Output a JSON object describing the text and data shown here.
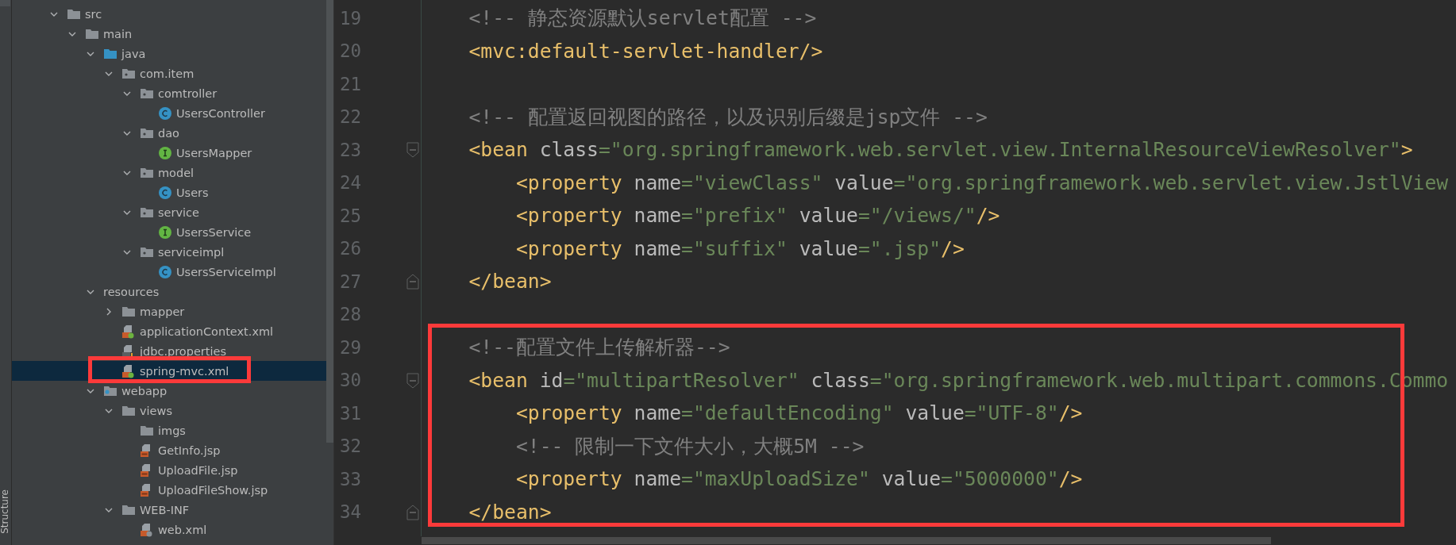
{
  "side_strip": {
    "tab": "Structure"
  },
  "project_tree": {
    "items": [
      {
        "name": "src",
        "kind": "folder",
        "expanded": true,
        "selected": false,
        "boxed": false,
        "children": [
          {
            "name": "main",
            "kind": "folder",
            "expanded": true,
            "selected": false,
            "boxed": false,
            "children": [
              {
                "name": "java",
                "kind": "source-folder",
                "expanded": true,
                "selected": false,
                "boxed": false,
                "children": [
                  {
                    "name": "com.item",
                    "kind": "package",
                    "expanded": true,
                    "selected": false,
                    "boxed": false,
                    "children": [
                      {
                        "name": "comtroller",
                        "kind": "package",
                        "expanded": true,
                        "selected": false,
                        "boxed": false,
                        "children": [
                          {
                            "name": "UsersController",
                            "kind": "class",
                            "selected": false,
                            "boxed": false
                          }
                        ]
                      },
                      {
                        "name": "dao",
                        "kind": "package",
                        "expanded": true,
                        "selected": false,
                        "boxed": false,
                        "children": [
                          {
                            "name": "UsersMapper",
                            "kind": "interface",
                            "selected": false,
                            "boxed": false
                          }
                        ]
                      },
                      {
                        "name": "model",
                        "kind": "package",
                        "expanded": true,
                        "selected": false,
                        "boxed": false,
                        "children": [
                          {
                            "name": "Users",
                            "kind": "class",
                            "selected": false,
                            "boxed": false
                          }
                        ]
                      },
                      {
                        "name": "service",
                        "kind": "package",
                        "expanded": true,
                        "selected": false,
                        "boxed": false,
                        "children": [
                          {
                            "name": "UsersService",
                            "kind": "interface",
                            "selected": false,
                            "boxed": false
                          }
                        ]
                      },
                      {
                        "name": "serviceimpl",
                        "kind": "package",
                        "expanded": true,
                        "selected": false,
                        "boxed": false,
                        "children": [
                          {
                            "name": "UsersServiceImpl",
                            "kind": "class",
                            "selected": false,
                            "boxed": false
                          }
                        ]
                      }
                    ]
                  }
                ]
              },
              {
                "name": "resources",
                "kind": "plain",
                "expanded": true,
                "selected": false,
                "boxed": false,
                "children": [
                  {
                    "name": "mapper",
                    "kind": "folder",
                    "expanded": false,
                    "selected": false,
                    "boxed": false
                  },
                  {
                    "name": "applicationContext.xml",
                    "kind": "spring-xml",
                    "selected": false,
                    "boxed": false
                  },
                  {
                    "name": "jdbc.properties",
                    "kind": "properties",
                    "selected": false,
                    "boxed": false
                  },
                  {
                    "name": "spring-mvc.xml",
                    "kind": "spring-xml",
                    "selected": true,
                    "boxed": true
                  }
                ]
              },
              {
                "name": "webapp",
                "kind": "web-folder",
                "expanded": true,
                "selected": false,
                "boxed": false,
                "children": [
                  {
                    "name": "views",
                    "kind": "folder",
                    "expanded": true,
                    "selected": false,
                    "boxed": false,
                    "children": [
                      {
                        "name": "imgs",
                        "kind": "folder",
                        "selected": false,
                        "boxed": false
                      },
                      {
                        "name": "GetInfo.jsp",
                        "kind": "jsp",
                        "selected": false,
                        "boxed": false
                      },
                      {
                        "name": "UploadFile.jsp",
                        "kind": "jsp",
                        "selected": false,
                        "boxed": false
                      },
                      {
                        "name": "UploadFileShow.jsp",
                        "kind": "jsp",
                        "selected": false,
                        "boxed": false
                      }
                    ]
                  },
                  {
                    "name": "WEB-INF",
                    "kind": "folder",
                    "expanded": true,
                    "selected": false,
                    "boxed": false,
                    "children": [
                      {
                        "name": "web.xml",
                        "kind": "web-xml",
                        "selected": false,
                        "boxed": false
                      }
                    ]
                  }
                ]
              }
            ]
          }
        ]
      }
    ]
  },
  "editor": {
    "lines": [
      {
        "number": "19",
        "kind": "code",
        "boxed": false,
        "tokens": [
          {
            "kind": "comment",
            "text": "    <!-- 静态资源默认servlet配置 -->"
          }
        ]
      },
      {
        "number": "20",
        "kind": "code",
        "boxed": false,
        "tokens": [
          {
            "kind": "tag",
            "text": "    <mvc:default-servlet-handler/>"
          }
        ]
      },
      {
        "number": "21",
        "kind": "code",
        "boxed": false
      },
      {
        "number": "22",
        "kind": "code",
        "boxed": false,
        "tokens": [
          {
            "kind": "comment",
            "text": "    <!-- 配置返回视图的路径，以及识别后缀是jsp文件 -->"
          }
        ]
      },
      {
        "number": "23",
        "kind": "fold-start",
        "boxed": false,
        "tokens": [
          {
            "kind": "tag",
            "text": "    <bean"
          },
          {
            "kind": "attr",
            "text": " class"
          },
          {
            "kind": "string",
            "text": "=\"org.springframework.web.servlet.view.InternalResourceViewResolver\""
          },
          {
            "kind": "tag",
            "text": ">"
          }
        ]
      },
      {
        "number": "24",
        "kind": "code",
        "boxed": false,
        "tokens": [
          {
            "kind": "tag",
            "text": "        <property"
          },
          {
            "kind": "attr",
            "text": " name"
          },
          {
            "kind": "string",
            "text": "=\"viewClass\""
          },
          {
            "kind": "attr",
            "text": " value"
          },
          {
            "kind": "string",
            "text": "=\"org.springframework.web.servlet.view.JstlView"
          }
        ]
      },
      {
        "number": "25",
        "kind": "code",
        "boxed": false,
        "tokens": [
          {
            "kind": "tag",
            "text": "        <property"
          },
          {
            "kind": "attr",
            "text": " name"
          },
          {
            "kind": "string",
            "text": "=\"prefix\""
          },
          {
            "kind": "attr",
            "text": " value"
          },
          {
            "kind": "string",
            "text": "=\"/views/\""
          },
          {
            "kind": "tag",
            "text": "/>"
          }
        ]
      },
      {
        "number": "26",
        "kind": "code",
        "boxed": false,
        "tokens": [
          {
            "kind": "tag",
            "text": "        <property"
          },
          {
            "kind": "attr",
            "text": " name"
          },
          {
            "kind": "string",
            "text": "=\"suffix\""
          },
          {
            "kind": "attr",
            "text": " value"
          },
          {
            "kind": "string",
            "text": "=\".jsp\""
          },
          {
            "kind": "tag",
            "text": "/>"
          }
        ]
      },
      {
        "number": "27",
        "kind": "fold-end",
        "boxed": false,
        "tokens": [
          {
            "kind": "tag",
            "text": "    </bean>"
          }
        ]
      },
      {
        "number": "28",
        "kind": "code",
        "boxed": false
      },
      {
        "number": "29",
        "kind": "code",
        "boxed": true,
        "tokens": [
          {
            "kind": "comment",
            "text": "    <!--配置文件上传解析器-->"
          }
        ]
      },
      {
        "number": "30",
        "kind": "fold-start",
        "boxed": true,
        "tokens": [
          {
            "kind": "tag",
            "text": "    <bean"
          },
          {
            "kind": "attr",
            "text": " id"
          },
          {
            "kind": "string",
            "text": "=\"multipartResolver\""
          },
          {
            "kind": "attr",
            "text": " class"
          },
          {
            "kind": "string",
            "text": "=\"org.springframework.web.multipart.commons.Commo"
          }
        ]
      },
      {
        "number": "31",
        "kind": "code",
        "boxed": true,
        "tokens": [
          {
            "kind": "tag",
            "text": "        <property"
          },
          {
            "kind": "attr",
            "text": " name"
          },
          {
            "kind": "string",
            "text": "=\"defaultEncoding\""
          },
          {
            "kind": "attr",
            "text": " value"
          },
          {
            "kind": "string",
            "text": "=\"UTF-8\""
          },
          {
            "kind": "tag",
            "text": "/>"
          }
        ]
      },
      {
        "number": "32",
        "kind": "code",
        "boxed": true,
        "tokens": [
          {
            "kind": "comment",
            "text": "        <!-- 限制一下文件大小，大概5M -->"
          }
        ]
      },
      {
        "number": "33",
        "kind": "code",
        "boxed": true,
        "tokens": [
          {
            "kind": "tag",
            "text": "        <property"
          },
          {
            "kind": "attr",
            "text": " name"
          },
          {
            "kind": "string",
            "text": "=\"maxUploadSize\""
          },
          {
            "kind": "attr",
            "text": " value"
          },
          {
            "kind": "string",
            "text": "=\"5000000\""
          },
          {
            "kind": "tag",
            "text": "/>"
          }
        ]
      },
      {
        "number": "34",
        "kind": "fold-end",
        "boxed": true,
        "tokens": [
          {
            "kind": "tag",
            "text": "    </bean>"
          }
        ]
      }
    ]
  }
}
